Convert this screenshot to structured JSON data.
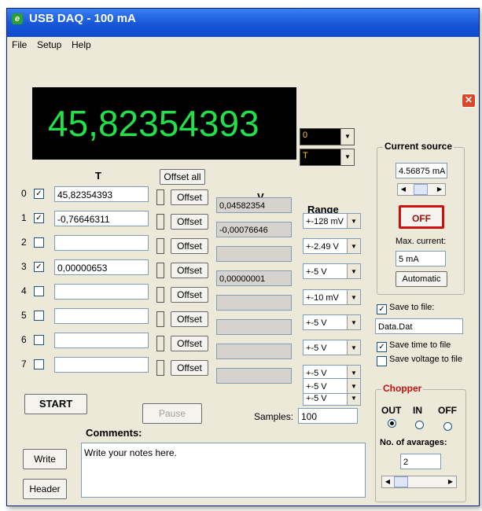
{
  "window": {
    "title": "USB DAQ - 100 mA"
  },
  "menu": [
    "File",
    "Setup",
    "Help"
  ],
  "display": {
    "value": "45,82354393"
  },
  "channel_combo": {
    "value": "0"
  },
  "type_combo": {
    "value": "T"
  },
  "headers": {
    "t": "T",
    "v": "V",
    "range": "Range"
  },
  "buttons": {
    "offset_all": "Offset all",
    "offset": "Offset",
    "start": "START",
    "pause": "Pause",
    "write": "Write",
    "header": "Header",
    "automatic": "Automatic",
    "off": "OFF"
  },
  "channels": [
    {
      "index": "0",
      "checked": true,
      "t": "45,82354393",
      "v": "0,04582354",
      "range": "+-128 mV"
    },
    {
      "index": "1",
      "checked": true,
      "t": "-0,76646311",
      "v": "-0,00076646",
      "range": "+-2.49 V"
    },
    {
      "index": "2",
      "checked": false,
      "t": "",
      "v": "",
      "range": "+-5 V"
    },
    {
      "index": "3",
      "checked": true,
      "t": "0,00000653",
      "v": "0,00000001",
      "range": "+-10 mV"
    },
    {
      "index": "4",
      "checked": false,
      "t": "",
      "v": "",
      "range": "+-5 V"
    },
    {
      "index": "5",
      "checked": false,
      "t": "",
      "v": "",
      "range": "+-5 V"
    },
    {
      "index": "6",
      "checked": false,
      "t": "",
      "v": "",
      "range": "+-5 V"
    },
    {
      "index": "7",
      "checked": false,
      "t": "",
      "v": "",
      "range": "+-5 V"
    }
  ],
  "range_extra": "+-5 V",
  "samples": {
    "label": "Samples:",
    "value": "100"
  },
  "comments": {
    "label": "Comments:",
    "text": "Write your notes here."
  },
  "current_source": {
    "title": "Current source",
    "value": "4.56875 mA",
    "max_label": "Max. current:",
    "max_value": "5 mA"
  },
  "save": {
    "save_to_file": "Save to file:",
    "file": "Data.Dat",
    "save_time": "Save time to file",
    "save_voltage": "Save voltage to file",
    "save_to_file_checked": true,
    "save_time_checked": true,
    "save_voltage_checked": false
  },
  "chopper": {
    "title": "Chopper",
    "out": "OUT",
    "in": "IN",
    "off": "OFF",
    "selected": "OUT",
    "averages_label": "No. of avarages:",
    "averages_value": "2"
  },
  "colors": {
    "display_text": "#22e04a",
    "titlebar": "#0b42c4",
    "off_border": "#d01010"
  }
}
